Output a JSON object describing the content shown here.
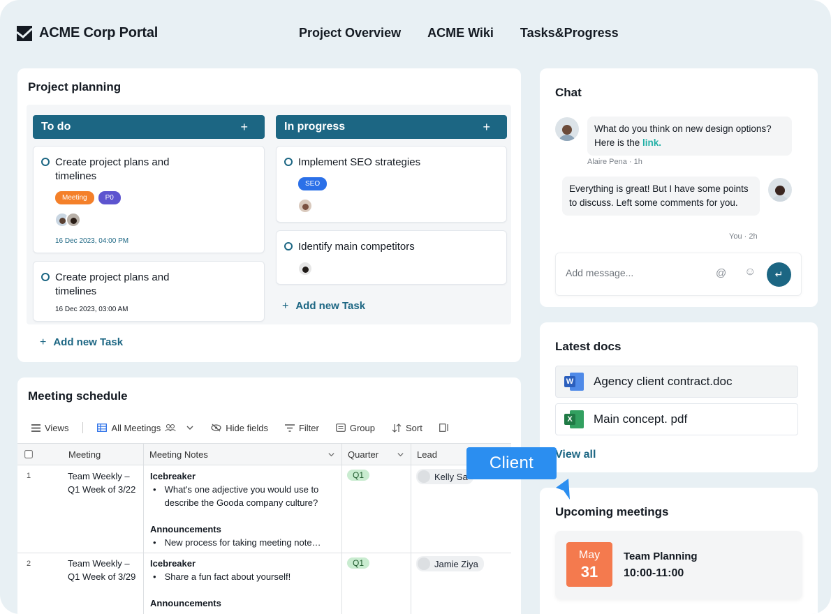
{
  "header": {
    "brand": "ACME Corp Portal",
    "nav": [
      "Project Overview",
      "ACME Wiki",
      "Tasks&Progress"
    ]
  },
  "planning": {
    "title": "Project planning",
    "columns": [
      {
        "title": "To do",
        "add_label": "+",
        "cards": [
          {
            "title": "Create project plans and timelines",
            "tags": [
              "Meeting",
              "P0"
            ],
            "date": "16 Dec 2023, 04:00 PM"
          },
          {
            "title": "Create project plans and timelines",
            "date": "16 Dec 2023, 03:00 AM"
          }
        ],
        "add_task": "Add new Task"
      },
      {
        "title": "In progress",
        "add_label": "+",
        "cards": [
          {
            "title": "Implement SEO strategies",
            "tags": [
              "SEO"
            ]
          },
          {
            "title": "Identify main competitors"
          }
        ],
        "add_task": "Add new Task"
      }
    ]
  },
  "meetings": {
    "title": "Meeting schedule",
    "toolbar": {
      "views": "Views",
      "all_meetings": "All Meetings",
      "hide_fields": "Hide fields",
      "filter": "Filter",
      "group": "Group",
      "sort": "Sort"
    },
    "columns": [
      "Meeting",
      "Meeting Notes",
      "Quarter",
      "Lead"
    ],
    "rows": [
      {
        "num": "1",
        "meeting": "Team Weekly – Q1 Week of 3/22",
        "h1": "Icebreaker",
        "b1": "What's one adjective you would use to describe the Gooda company culture?",
        "h2": "Announcements",
        "b2": "New process for taking meeting note…",
        "quarter": "Q1",
        "lead": "Kelly Sa"
      },
      {
        "num": "2",
        "meeting": "Team Weekly – Q1 Week of 3/29",
        "h1": "Icebreaker",
        "b1": "Share a fun fact about yourself!",
        "h2": "Announcements",
        "quarter": "Q1",
        "lead": "Jamie Ziya"
      }
    ]
  },
  "chat": {
    "title": "Chat",
    "m1_text": "What do you think on new design options? Here is the",
    "m1_link": "link.",
    "m1_meta": "Alaire Pena · 1h",
    "m2_text": "Everything is great! But I have some points to discuss. Left some comments for you.",
    "m2_meta": "You · 2h",
    "placeholder": "Add message...",
    "at_icon": "@",
    "emoji_icon": "☺",
    "send_icon": "↵"
  },
  "docs": {
    "title": "Latest docs",
    "items": [
      {
        "name": "Agency client contract.doc",
        "icon": "word-icon",
        "letter": "W",
        "color": "#2b5fbd"
      },
      {
        "name": "Main concept. pdf",
        "icon": "excel-icon",
        "letter": "X",
        "color": "#1f7a45"
      }
    ],
    "view_all": "View all"
  },
  "upcoming": {
    "title": "Upcoming meetings",
    "month": "May",
    "day": "31",
    "name": "Team Planning",
    "time": "10:00-11:00"
  },
  "client_label": "Client",
  "colors": {
    "accent": "#1c6683",
    "bg": "#e8f0f4",
    "calendar": "#f47a4e",
    "client": "#2b8ef0"
  }
}
